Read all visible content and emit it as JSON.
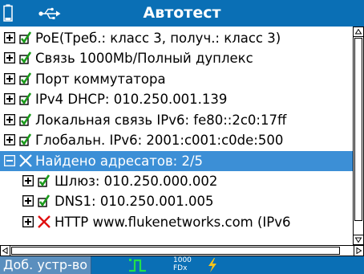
{
  "window": {
    "title": "Автотест"
  },
  "tree": {
    "rows": [
      {
        "label": "PoE(Треб.: класс 3, получ.: класс 3)",
        "status": "pass",
        "expander": "plus",
        "selected": false
      },
      {
        "label": "Связь 1000Mb/Полный дуплекс",
        "status": "pass",
        "expander": "plus",
        "selected": false
      },
      {
        "label": "Порт коммутатора",
        "status": "pass",
        "expander": "plus",
        "selected": false
      },
      {
        "label": "IPv4 DHCP: 010.250.001.139",
        "status": "pass",
        "expander": "plus",
        "selected": false
      },
      {
        "label": "Локальная связь IPv6: fe80::2c0:17ff",
        "status": "pass",
        "expander": "plus",
        "selected": false
      },
      {
        "label": "Глобальн. IPv6: 2001:c001:c0de:500",
        "status": "pass",
        "expander": "plus",
        "selected": false
      },
      {
        "label": "Найдено адресатов: 2/5",
        "status": "fail",
        "expander": "minus",
        "selected": true
      },
      {
        "label": "Шлюз: 010.250.000.002",
        "status": "pass",
        "expander": "plus",
        "selected": false
      },
      {
        "label": "DNS1: 010.250.001.005",
        "status": "pass",
        "expander": "plus",
        "selected": false
      },
      {
        "label": "HTTP www.flukenetworks.com (IPv6",
        "status": "fail",
        "expander": "plus",
        "selected": false
      }
    ]
  },
  "statusbar": {
    "add_device_label": "Доб. устр-во",
    "link_speed": "1000",
    "duplex": "FDx"
  },
  "colors": {
    "titlebar": "#0a6fb5",
    "selection": "#3c8fd6",
    "pass_check": "#1a9a1a",
    "fail_x": "#e01010",
    "link_icon": "#22e04a",
    "power_icon": "#f7c21a"
  },
  "icons": {
    "battery": "battery-icon",
    "usb": "usb-icon",
    "link": "link-pulse-icon",
    "power": "lightning-icon"
  }
}
